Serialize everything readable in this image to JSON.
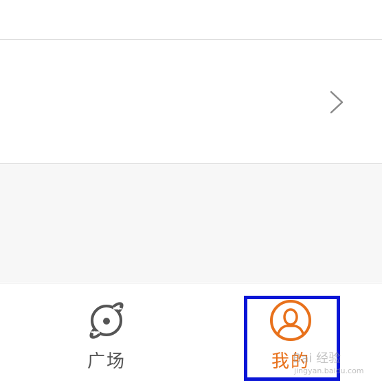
{
  "tabbar": {
    "tabs": [
      {
        "label": "广场",
        "icon": "planet-icon",
        "active": false
      },
      {
        "label": "我的",
        "icon": "user-avatar-icon",
        "active": true
      }
    ]
  },
  "colors": {
    "active": "#e8711b",
    "inactive": "#555555",
    "highlight_box": "#0a16d6",
    "band": "#f7f7f7"
  },
  "watermark": {
    "text": "Bai 经验",
    "sub": "jingyan.baidu.com"
  }
}
